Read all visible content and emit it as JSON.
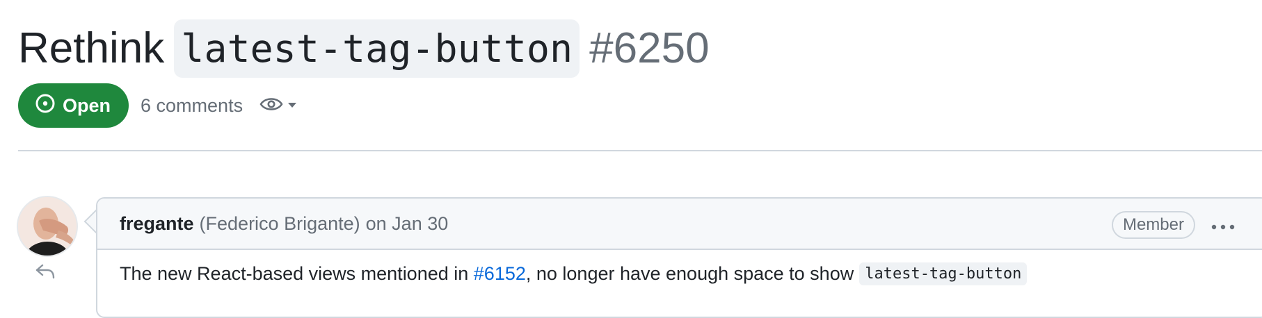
{
  "issue": {
    "title_prefix": "Rethink",
    "title_code": "latest-tag-button",
    "number": "#6250"
  },
  "meta": {
    "state": "Open",
    "state_color": "#1f883d",
    "comments": "6 comments",
    "icons": [
      "issue-open-icon",
      "eye-icon",
      "caret-down-icon"
    ]
  },
  "comment": {
    "author": "fregante",
    "full_name": "(Federico Brigante)",
    "date": "on Jan 30",
    "role": "Member",
    "body_prefix": "The new React-based views mentioned in ",
    "body_link": "#6152",
    "body_middle": ", no longer have enough space to show",
    "body_code": "latest-tag-button",
    "icons": [
      "avatar",
      "reply-icon",
      "kebab-menu-icon"
    ]
  },
  "colors": {
    "link": "#0969da",
    "muted": "#656d76",
    "border": "#d0d7de"
  }
}
